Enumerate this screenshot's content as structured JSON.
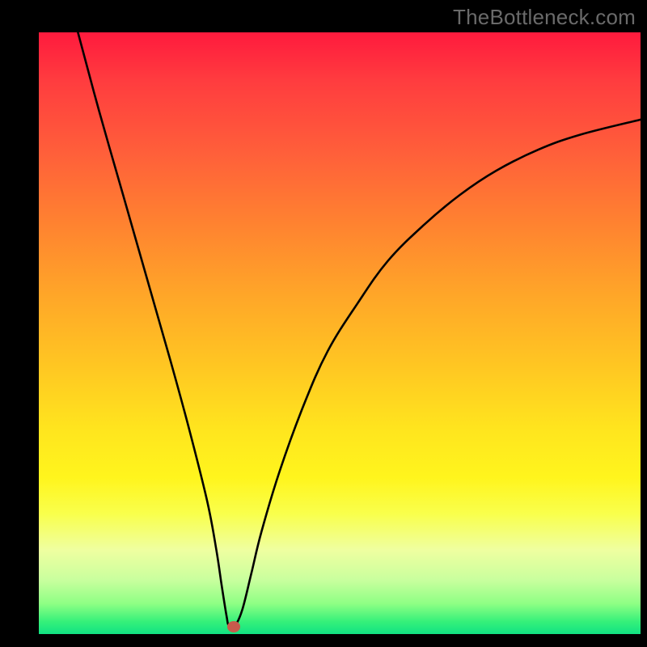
{
  "watermark_text": "TheBottleneck.com",
  "chart_data": {
    "type": "line",
    "title": "",
    "xlabel": "",
    "ylabel": "",
    "xlim": [
      0,
      100
    ],
    "ylim": [
      0,
      100
    ],
    "grid": false,
    "series": [
      {
        "name": "bottleneck-curve",
        "x": [
          6.5,
          10,
          14,
          18,
          22,
          25,
          28,
          29.5,
          30.4,
          31.2,
          31.6,
          32.6,
          33.8,
          35.3,
          37,
          40,
          44,
          48,
          53,
          58,
          64,
          70,
          76,
          83,
          90,
          100
        ],
        "values": [
          100,
          87,
          73,
          59,
          45,
          34,
          22,
          14,
          8,
          3,
          1.4,
          1.4,
          4,
          10,
          17,
          27,
          38,
          47,
          55,
          62,
          68,
          73,
          77,
          80.5,
          83,
          85.5
        ]
      }
    ],
    "annotations": [
      {
        "name": "optimal-point",
        "x": 32.4,
        "y": 1.2
      }
    ],
    "background_gradient": {
      "direction": "vertical",
      "stops": [
        {
          "offset": 0.0,
          "color": "#ff1a3d"
        },
        {
          "offset": 0.56,
          "color": "#ffc822"
        },
        {
          "offset": 0.8,
          "color": "#f9ff4c"
        },
        {
          "offset": 1.0,
          "color": "#11e283"
        }
      ]
    }
  }
}
